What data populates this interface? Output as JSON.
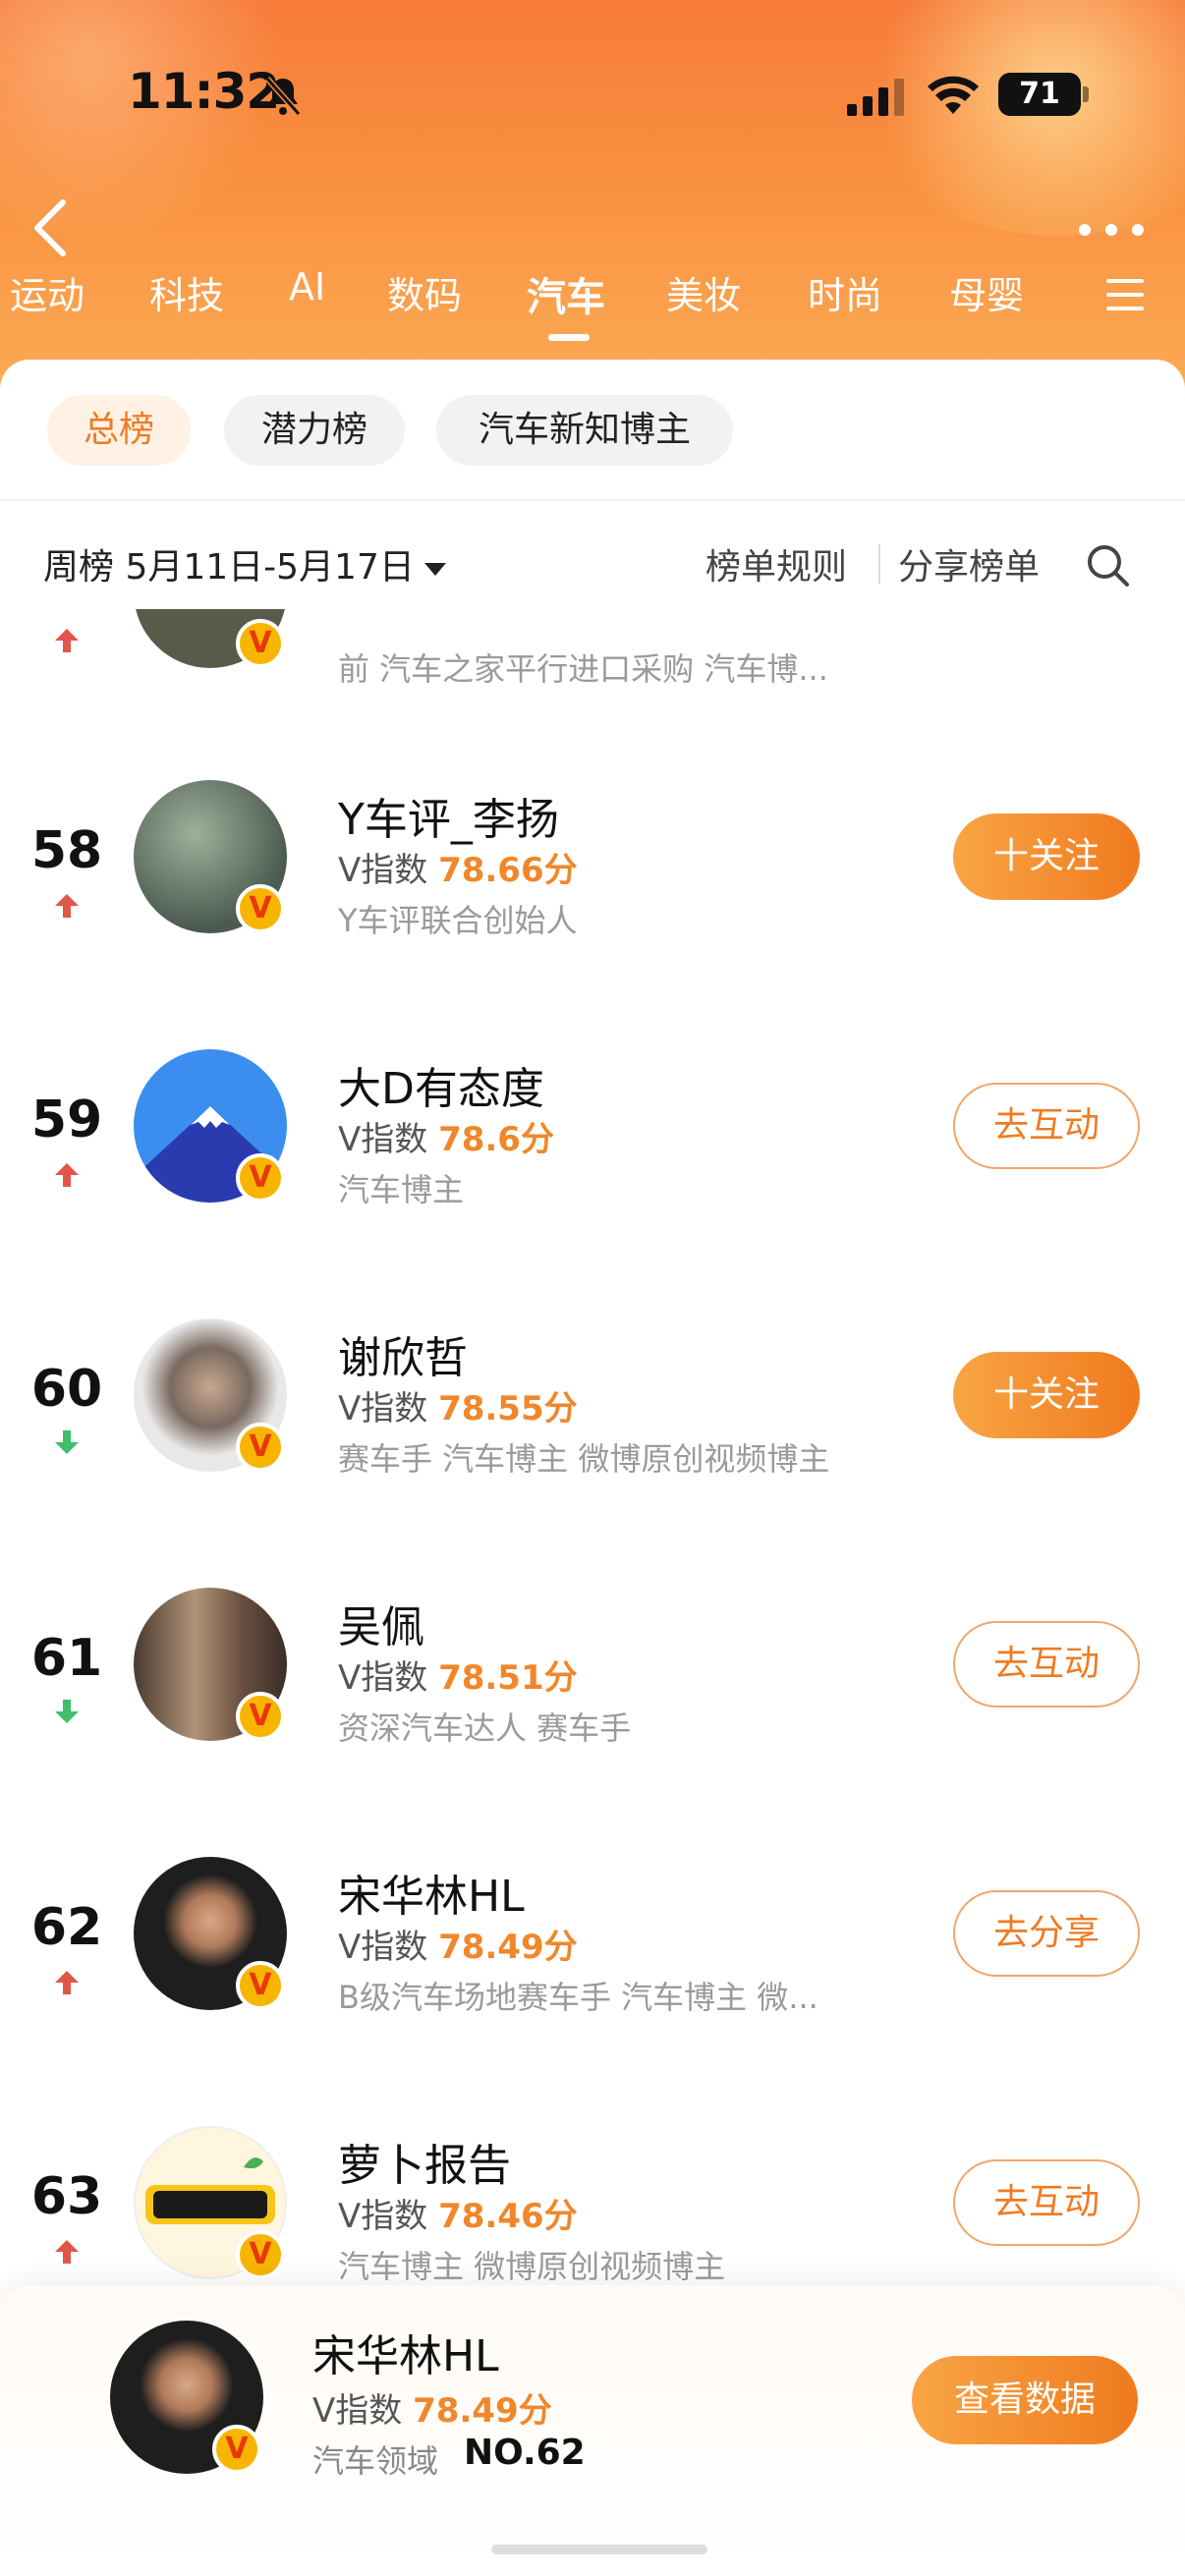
{
  "status_bar": {
    "time": "11:32",
    "battery": "71"
  },
  "categories": [
    "运动",
    "科技",
    "AI",
    "数码",
    "汽车",
    "美妆",
    "时尚",
    "母婴"
  ],
  "active_category": "汽车",
  "sub_tabs": [
    "总榜",
    "潜力榜",
    "汽车新知博主"
  ],
  "filter": {
    "week": "周榜 5月11日-5月17日",
    "rules": "榜单规则",
    "share": "分享榜单"
  },
  "partial_row": {
    "desc": "前 汽车之家平行进口采购 汽车博..."
  },
  "entries": [
    {
      "rank": "58",
      "trend": "up",
      "name": "Y车评_李扬",
      "v_label": "V指数",
      "score": "78.66分",
      "desc": "Y车评联合创始人",
      "button": "十关注",
      "button_style": "solid",
      "avatar_color": "#6a7a70"
    },
    {
      "rank": "59",
      "trend": "up",
      "name": "大D有态度",
      "v_label": "V指数",
      "score": "78.6分",
      "desc": "汽车博主",
      "button": "去互动",
      "button_style": "outline",
      "avatar_color": "#3b8ef0"
    },
    {
      "rank": "60",
      "trend": "down",
      "name": "谢欣哲",
      "v_label": "V指数",
      "score": "78.55分",
      "desc": "赛车手 汽车博主 微博原创视频博主",
      "button": "十关注",
      "button_style": "solid",
      "avatar_color": "#d9d9d9"
    },
    {
      "rank": "61",
      "trend": "down",
      "name": "吴佩",
      "v_label": "V指数",
      "score": "78.51分",
      "desc": "资深汽车达人 赛车手",
      "button": "去互动",
      "button_style": "outline",
      "avatar_color": "#8a7560"
    },
    {
      "rank": "62",
      "trend": "up",
      "name": "宋华林HL",
      "v_label": "V指数",
      "score": "78.49分",
      "desc": "B级汽车场地赛车手 汽车博主 微...",
      "button": "去分享",
      "button_style": "outline",
      "avatar_color": "#1e1e1e"
    },
    {
      "rank": "63",
      "trend": "up",
      "name": "萝卜报告",
      "v_label": "V指数",
      "score": "78.46分",
      "desc": "汽车博主 微博原创视频博主",
      "button": "去互动",
      "button_style": "outline",
      "avatar_color": "#fff6df"
    }
  ],
  "bottom_card": {
    "name": "宋华林HL",
    "v_label": "V指数",
    "score": "78.49分",
    "domain": "汽车领域",
    "rank": "NO.62",
    "button": "查看数据"
  },
  "colors": {
    "accent": "#f07b22",
    "up": "#e0574a",
    "down": "#3fbf6a"
  }
}
